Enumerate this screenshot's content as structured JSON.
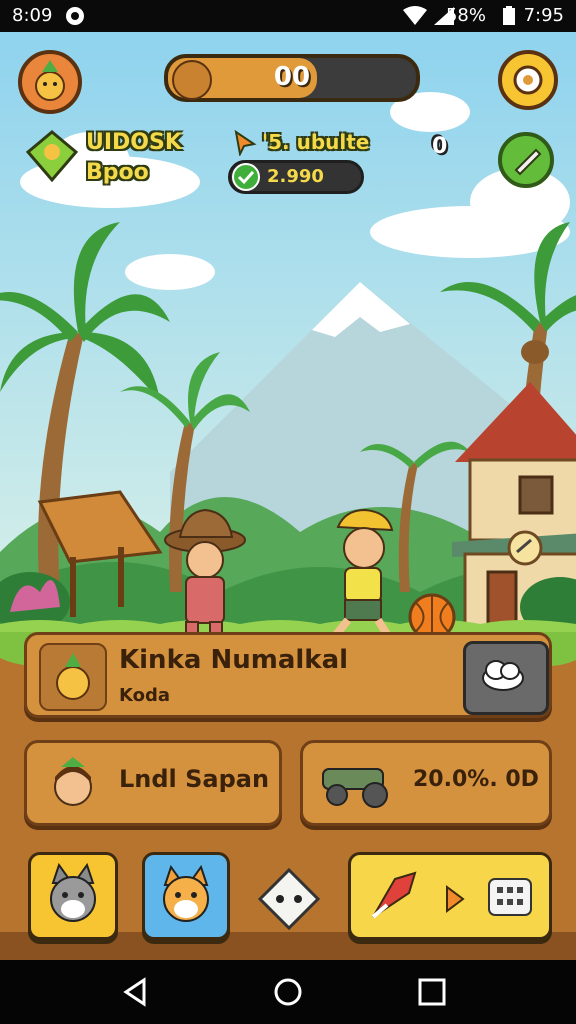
{
  "status_bar": {
    "time_left": "8:09",
    "battery": "58%",
    "time_right": "7:95"
  },
  "hud": {
    "progress_value": "00",
    "progress_fraction": 0.6,
    "player_line1": "UIDOSK",
    "player_line2": "Bpoo",
    "quest_label": "'5. ubulte",
    "check_value": "2.990",
    "counter": "0"
  },
  "panels": {
    "main_title": "Kinka Numalkal",
    "main_subtitle": "Koda",
    "friend_name": "Lndl Sapan",
    "vehicle_value": "20.0%. 0D"
  },
  "colors": {
    "sky": "#8fd3ee",
    "grass": "#7fc242",
    "soil": "#b7742f",
    "panel": "#d5923e",
    "accent_yellow": "#f7c531",
    "accent_green": "#3fae3a"
  },
  "icons": {
    "avatar": "pineapple-avatar-icon",
    "settings": "settings-cog-icon",
    "edit": "pencil-icon",
    "cloud": "cloud-icon",
    "cat": "cat-icon",
    "dog": "dog-icon",
    "dice": "dice-icon",
    "play": "arrow-right-icon",
    "grid": "dots-grid-icon"
  }
}
